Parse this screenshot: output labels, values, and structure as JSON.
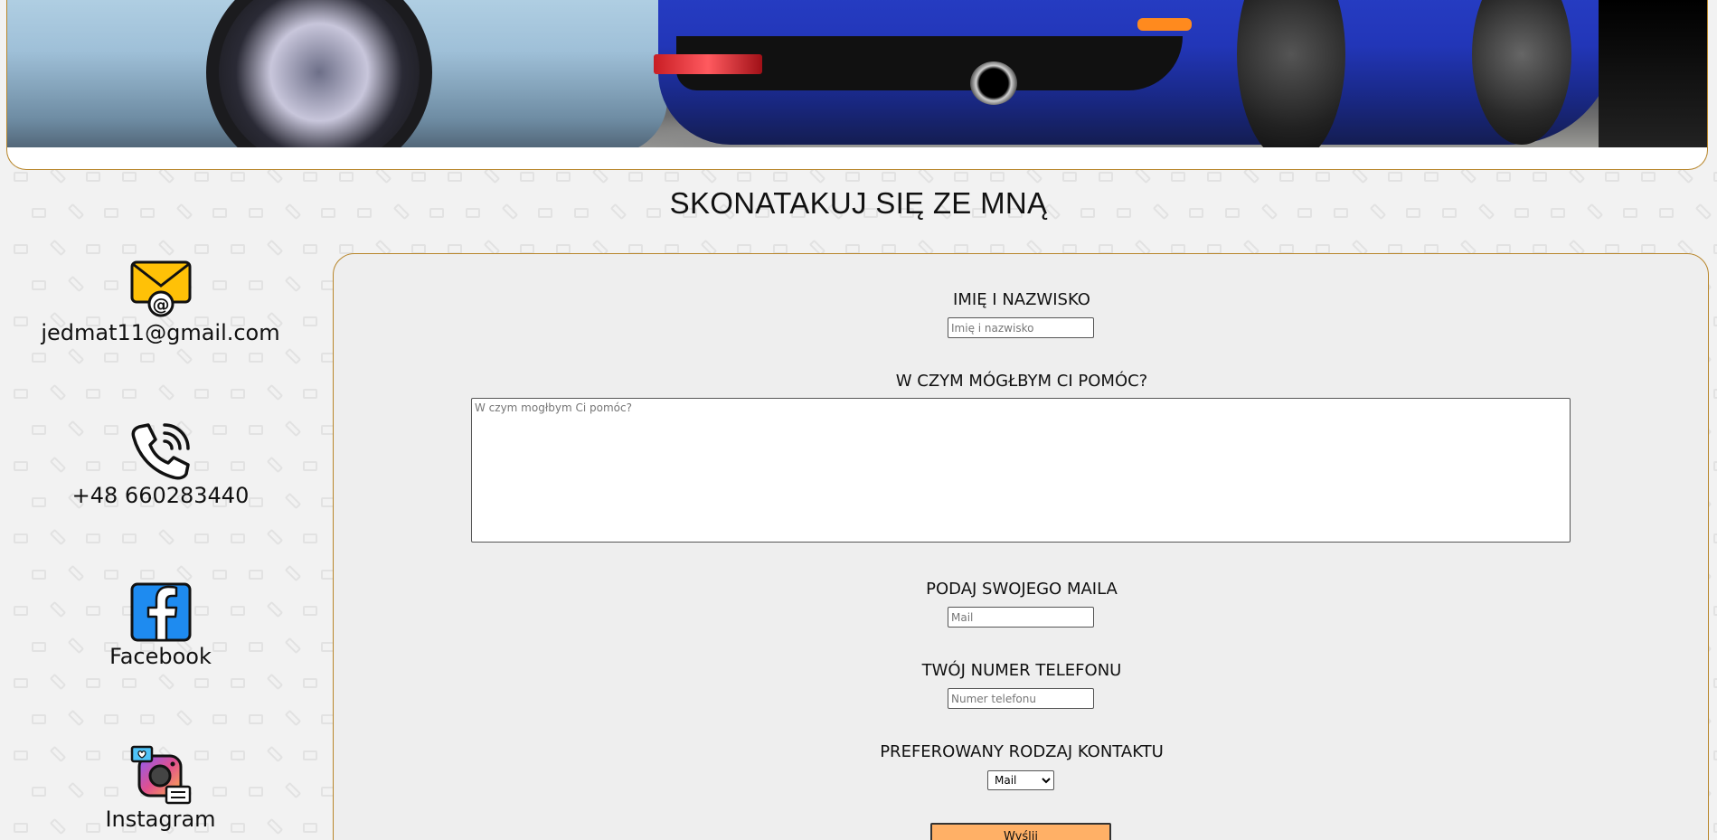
{
  "page": {
    "title": "SKONATAKUJ SIĘ ZE MNĄ",
    "accent_color": "#b8862b",
    "button_color": "#ffb066"
  },
  "contacts": [
    {
      "icon": "email-icon",
      "label": "jedmat11@gmail.com"
    },
    {
      "icon": "phone-icon",
      "label": "+48 660283440"
    },
    {
      "icon": "facebook-icon",
      "label": "Facebook"
    },
    {
      "icon": "instagram-icon",
      "label": "Instagram"
    }
  ],
  "form": {
    "name_label": "IMIĘ I NAZWISKO",
    "name_placeholder": "Imię i nazwisko",
    "message_label": "W CZYM MÓGŁBYM CI POMÓC?",
    "message_placeholder": "W czym mogłbym Ci pomóc?",
    "email_label": "PODAJ SWOJEGO MAILA",
    "email_placeholder": "Mail",
    "phone_label": "TWÓJ NUMER TELEFONU",
    "phone_placeholder": "Numer telefonu",
    "contact_type_label": "PREFEROWANY RODZAJ KONTAKTU",
    "contact_type_selected": "Mail",
    "submit_label": "Wyślij"
  }
}
